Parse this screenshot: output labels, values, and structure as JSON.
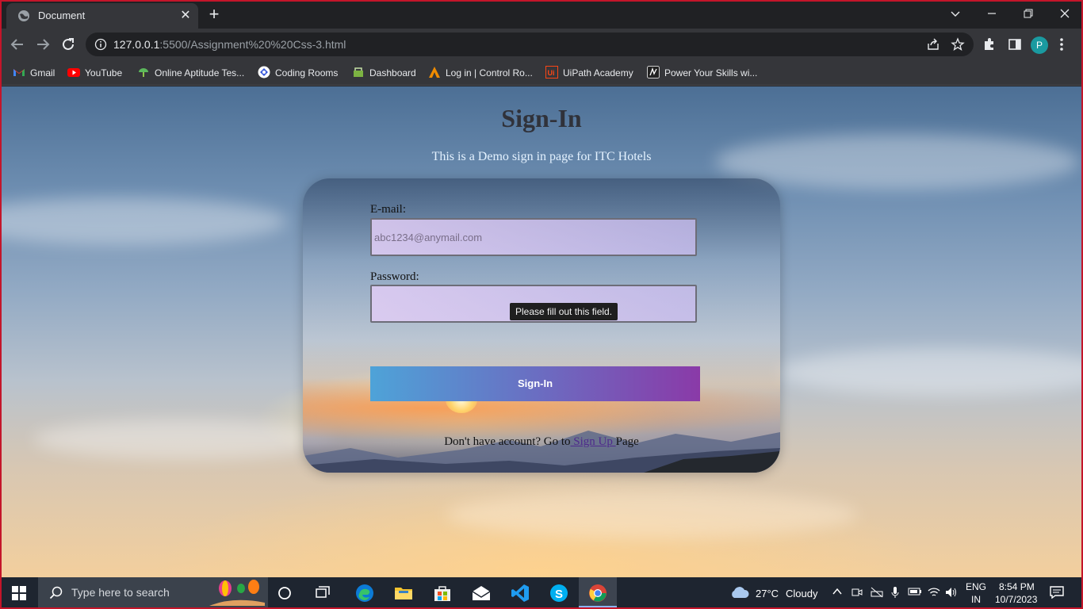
{
  "browser": {
    "tab_title": "Document",
    "tab_close": "✕",
    "new_tab": "+",
    "url_host": "127.0.0.1",
    "url_rest": ":5500/Assignment%20%20Css-3.html",
    "profile_initial": "P"
  },
  "bookmarks": [
    {
      "label": "Gmail",
      "icon": "gmail-icon"
    },
    {
      "label": "YouTube",
      "icon": "youtube-icon"
    },
    {
      "label": "Online Aptitude Tes...",
      "icon": "aptitude-icon"
    },
    {
      "label": "Coding Rooms",
      "icon": "coding-rooms-icon"
    },
    {
      "label": "Dashboard",
      "icon": "dashboard-icon"
    },
    {
      "label": "Log in | Control Ro...",
      "icon": "control-room-icon"
    },
    {
      "label": "UiPath Academy",
      "icon": "uipath-icon"
    },
    {
      "label": "Power Your Skills wi...",
      "icon": "power-skills-icon"
    }
  ],
  "page": {
    "title": "Sign-In",
    "subtitle": "This is a Demo sign in page for ITC Hotels",
    "email_label": "E-mail:",
    "email_placeholder": "abc1234@anymail.com",
    "password_label": "Password:",
    "tooltip": "Please fill out this field.",
    "signin_button": "Sign-In",
    "footer_prefix": "Don't have account? Go to",
    "footer_link": " Sign Up ",
    "footer_suffix": "Page"
  },
  "taskbar": {
    "search_placeholder": "Type here to search",
    "weather_temp": "27°C",
    "weather_desc": "Cloudy",
    "lang_top": "ENG",
    "lang_bottom": "IN",
    "time": "8:54 PM",
    "date": "10/7/2023"
  },
  "colors": {
    "accent_start": "#4ea3d8",
    "accent_end": "#8a3aa8",
    "frame_border": "#c4152a"
  }
}
